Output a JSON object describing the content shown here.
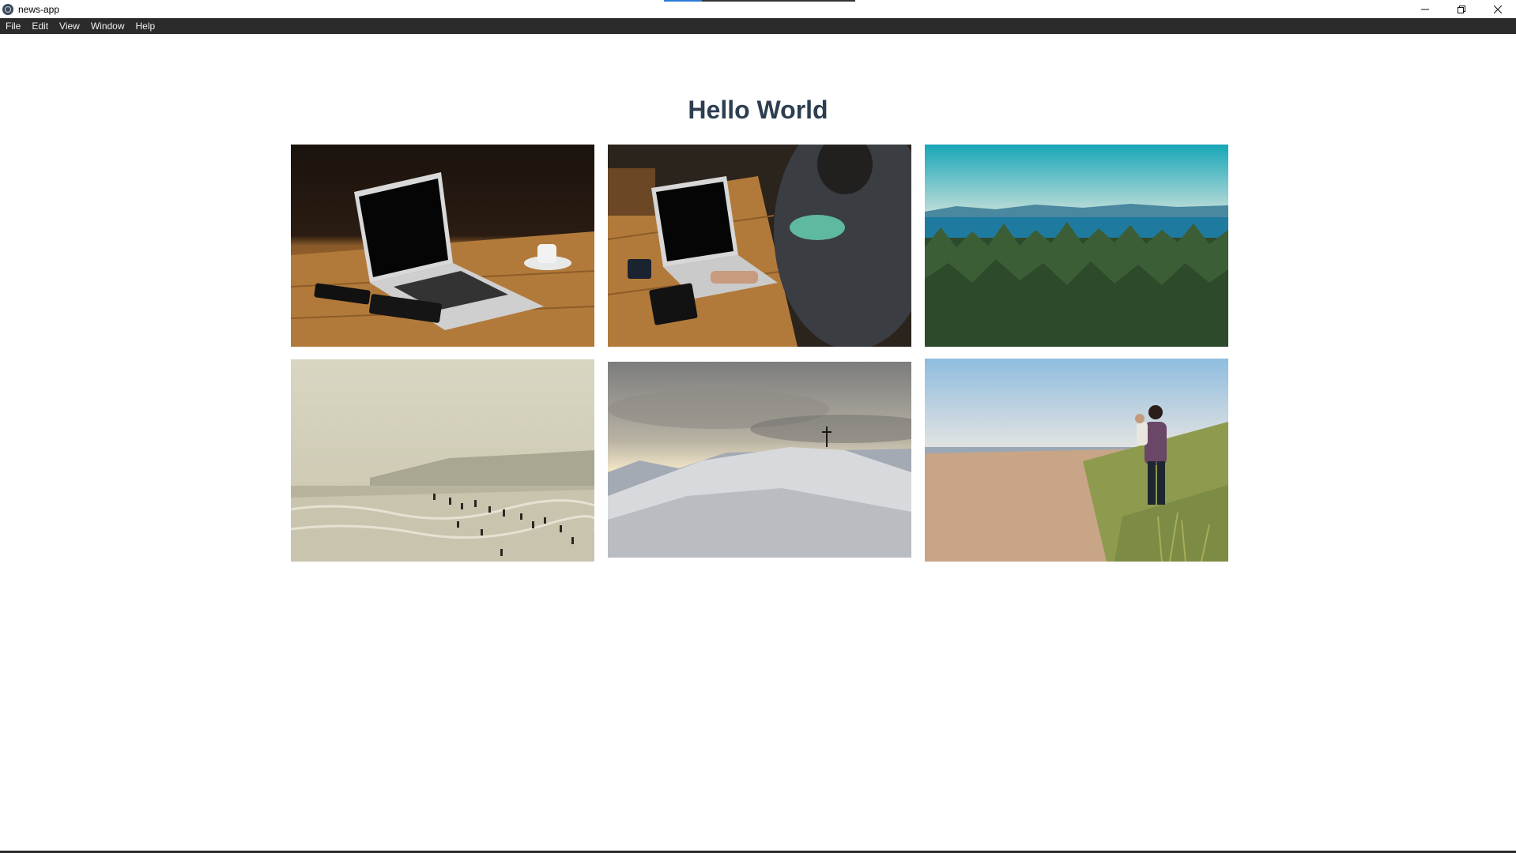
{
  "window": {
    "title": "news-app",
    "title_progress": 0.2
  },
  "menu": {
    "items": [
      "File",
      "Edit",
      "View",
      "Window",
      "Help"
    ]
  },
  "page": {
    "heading": "Hello World"
  },
  "gallery": {
    "photos": [
      {
        "subject": "laptop-on-wooden-table"
      },
      {
        "subject": "person-typing-on-laptop"
      },
      {
        "subject": "forest-and-sea"
      },
      {
        "subject": "hazy-beach-with-swimmers"
      },
      {
        "subject": "snowy-hill-with-cross"
      },
      {
        "subject": "man-carrying-child-on-beach"
      }
    ]
  },
  "colors": {
    "menubar_bg": "#2b2b2b",
    "heading": "#2c3e50",
    "progress_accent": "#2a7bd6"
  }
}
